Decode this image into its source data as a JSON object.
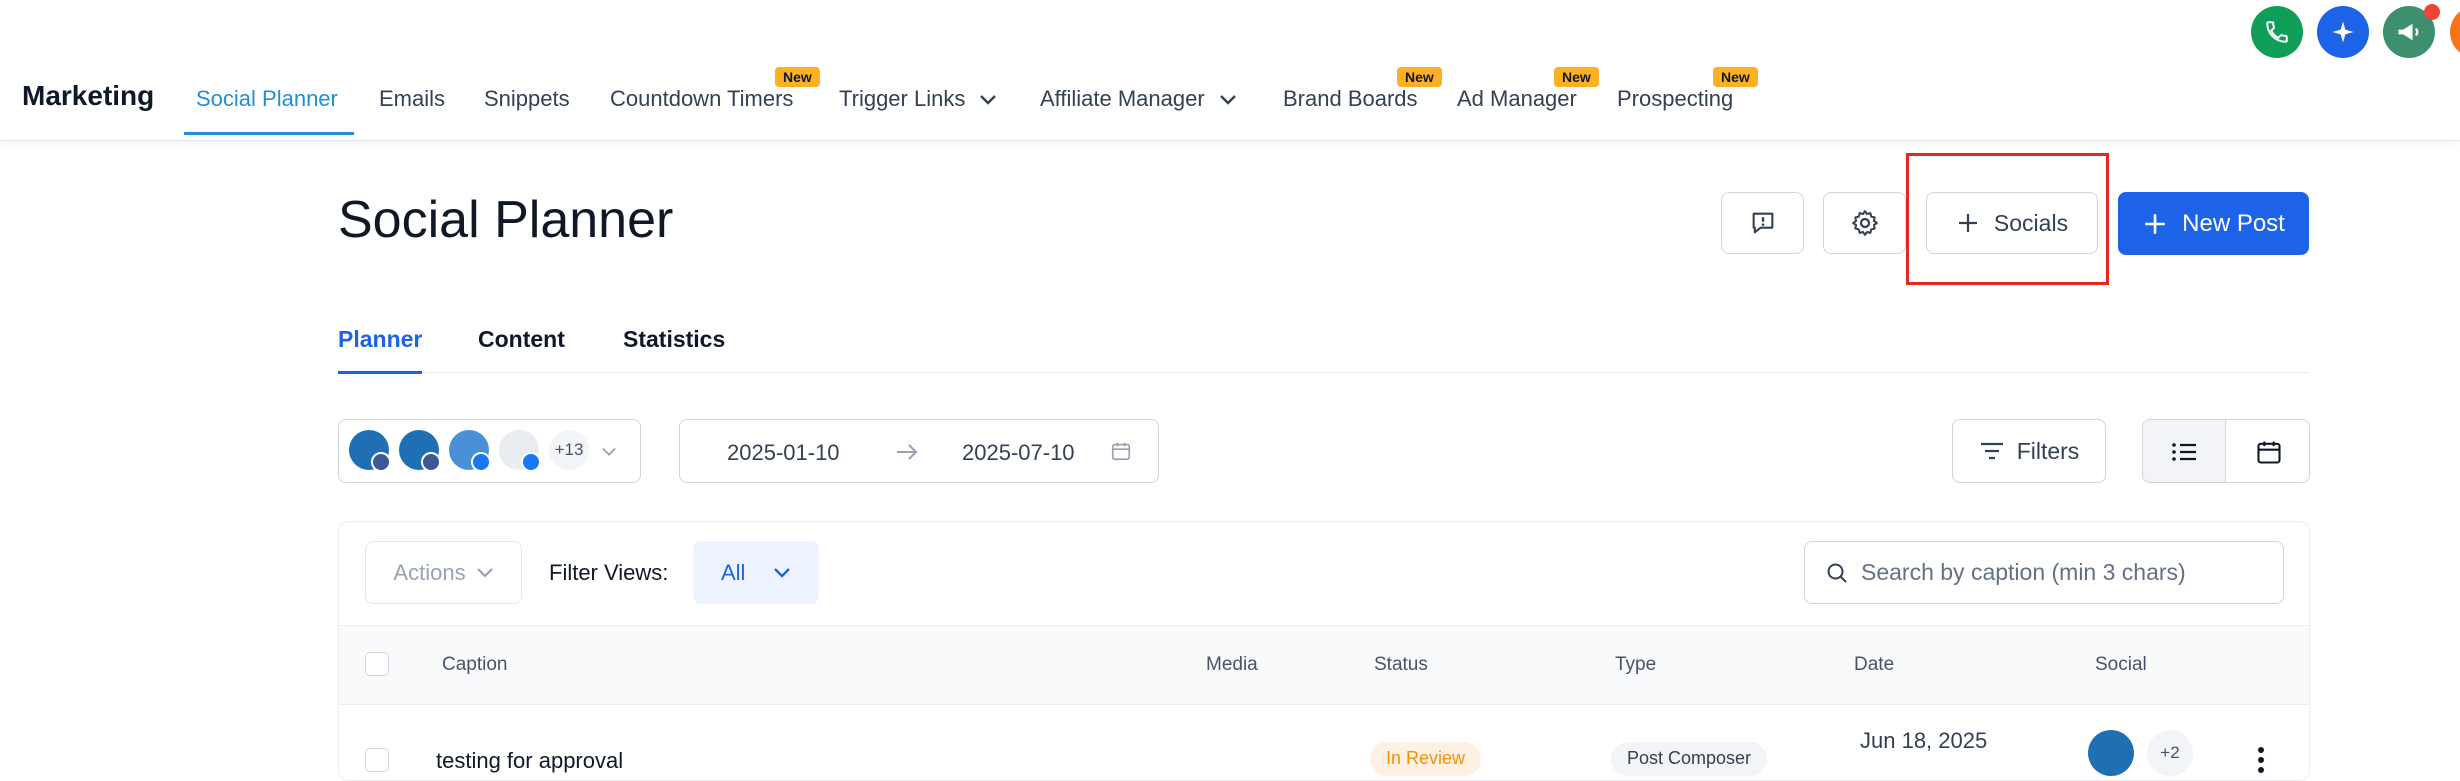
{
  "topnav": {
    "brand": "Marketing",
    "items": [
      {
        "label": "Social Planner",
        "active": true,
        "badge": "",
        "dropdown": false
      },
      {
        "label": "Emails",
        "active": false,
        "badge": "",
        "dropdown": false
      },
      {
        "label": "Snippets",
        "active": false,
        "badge": "",
        "dropdown": false
      },
      {
        "label": "Countdown Timers",
        "active": false,
        "badge": "New",
        "dropdown": false
      },
      {
        "label": "Trigger Links",
        "active": false,
        "badge": "",
        "dropdown": true
      },
      {
        "label": "Affiliate Manager",
        "active": false,
        "badge": "",
        "dropdown": true
      },
      {
        "label": "Brand Boards",
        "active": false,
        "badge": "New",
        "dropdown": false
      },
      {
        "label": "Ad Manager",
        "active": false,
        "badge": "New",
        "dropdown": false
      },
      {
        "label": "Prospecting",
        "active": false,
        "badge": "New",
        "dropdown": false
      }
    ],
    "badge_text": "New"
  },
  "header": {
    "title": "Social Planner",
    "socials_label": "Socials",
    "new_post_label": "New Post"
  },
  "subtabs": [
    {
      "label": "Planner",
      "active": true
    },
    {
      "label": "Content",
      "active": false
    },
    {
      "label": "Statistics",
      "active": false
    }
  ],
  "filters": {
    "accounts_more": "+13",
    "date_start": "2025-01-10",
    "date_end": "2025-07-10",
    "filters_label": "Filters"
  },
  "table": {
    "actions_label": "Actions",
    "filter_views_label": "Filter Views:",
    "filter_views_value": "All",
    "search_placeholder": "Search by caption (min 3 chars)",
    "columns": [
      "Caption",
      "Media",
      "Status",
      "Type",
      "Date",
      "Social"
    ],
    "rows": [
      {
        "caption": "testing for approval",
        "status": "In Review",
        "type": "Post Composer",
        "date": "Jun 18, 2025",
        "social_more": "+2"
      }
    ]
  },
  "colors": {
    "accent": "#1c63e8",
    "nav_active": "#1f8fd6",
    "badge": "#fdb022",
    "highlight": "#e4281f",
    "phone_btn": "#0f9d58",
    "ai_btn": "#1c63e8",
    "announce_btn": "#3e8f6d"
  }
}
